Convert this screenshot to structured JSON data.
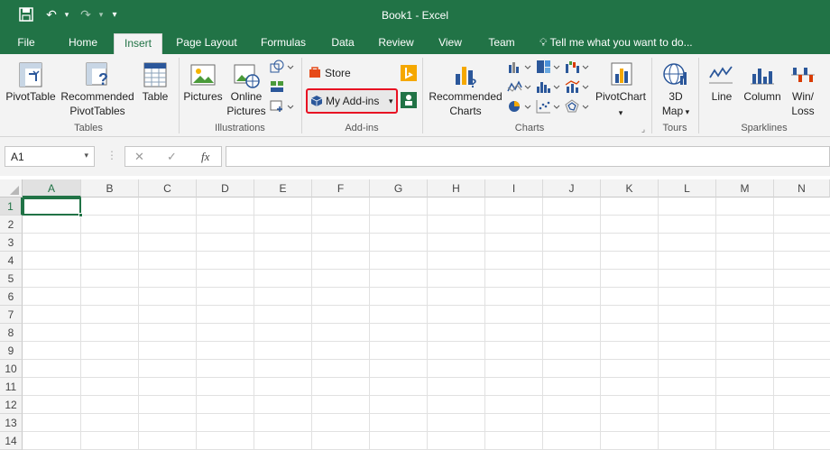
{
  "window": {
    "title": "Book1 - Excel"
  },
  "qat": {
    "save": "💾",
    "undo": "↶",
    "redo": "↷",
    "customize": "▾"
  },
  "tabs": [
    {
      "label": "File"
    },
    {
      "label": "Home"
    },
    {
      "label": "Insert"
    },
    {
      "label": "Page Layout"
    },
    {
      "label": "Formulas"
    },
    {
      "label": "Data"
    },
    {
      "label": "Review"
    },
    {
      "label": "View"
    },
    {
      "label": "Team"
    }
  ],
  "tell_me": {
    "icon": "lightbulb-icon",
    "text": "Tell me what you want to do..."
  },
  "ribbon": {
    "tables": {
      "group_label": "Tables",
      "pivot_table": "PivotTable",
      "recommended_pivot_1": "Recommended",
      "recommended_pivot_2": "PivotTables",
      "table": "Table"
    },
    "illustrations": {
      "group_label": "Illustrations",
      "pictures": "Pictures",
      "online_1": "Online",
      "online_2": "Pictures"
    },
    "addins": {
      "group_label": "Add-ins",
      "store": "Store",
      "my_addins": "My Add-ins",
      "highlight_color": "#e81123"
    },
    "charts": {
      "group_label": "Charts",
      "recommended_1": "Recommended",
      "recommended_2": "Charts",
      "pivot_chart": "PivotChart"
    },
    "tours": {
      "group_label": "Tours",
      "map_1": "3D",
      "map_2": "Map"
    },
    "sparklines": {
      "group_label": "Sparklines",
      "line": "Line",
      "column": "Column",
      "winloss_1": "Win/",
      "winloss_2": "Loss"
    }
  },
  "formula_bar": {
    "name_box": "A1",
    "cancel": "✕",
    "enter": "✓",
    "fx": "fx",
    "formula": ""
  },
  "sheet": {
    "columns": [
      "A",
      "B",
      "C",
      "D",
      "E",
      "F",
      "G",
      "H",
      "I",
      "J",
      "K",
      "L",
      "M",
      "N"
    ],
    "rows": [
      "1",
      "2",
      "3",
      "4",
      "5",
      "6",
      "7",
      "8",
      "9",
      "10",
      "11",
      "12",
      "13",
      "14"
    ],
    "active_cell": "A1"
  },
  "colors": {
    "accent": "#217346",
    "ribbon_bg": "#f3f3f3"
  }
}
